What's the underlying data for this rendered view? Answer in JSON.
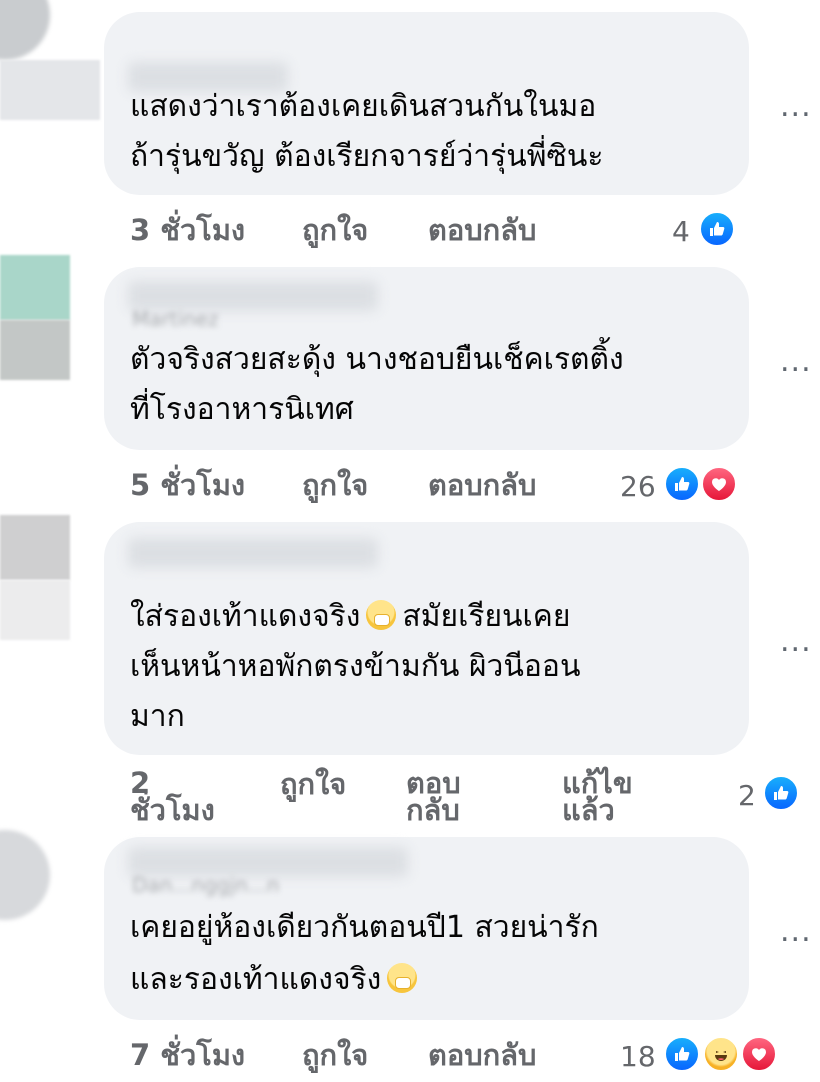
{
  "comments": [
    {
      "lines": [
        "แสดงว่าเราต้องเคยเดินสวนกันในมอ",
        "ถ้ารุ่นขวัญ ต้องเรียกจารย์ว่ารุ่นพี่ซินะ"
      ],
      "time": "3 ชั่วโมง",
      "like": "ถูกใจ",
      "reply": "ตอบกลับ",
      "reaction_count": "4",
      "reactions": [
        "like-icon"
      ]
    },
    {
      "name_fragment": "Martinez",
      "lines": [
        "ตัวจริงสวยสะดุ้ง นางชอบยืนเช็คเรตติ้ง",
        "ที่โรงอาหารนิเทศ"
      ],
      "time": "5 ชั่วโมง",
      "like": "ถูกใจ",
      "reply": "ตอบกลับ",
      "reaction_count": "26",
      "reactions": [
        "like-icon",
        "love-icon"
      ]
    },
    {
      "line1_a": "ใส่รองเท้าแดงจริง",
      "line1_b": "สมัยเรียนเคย",
      "lines": [
        "เห็นหน้าหอพักตรงข้ามกัน ผิวนีออน",
        "มาก"
      ],
      "time": "2 ชั่วโมง",
      "like": "ถูกใจ",
      "reply": "ตอบ กลับ",
      "edited": "แก้ไข แล้ว",
      "reaction_count": "2",
      "reactions": [
        "like-icon"
      ]
    },
    {
      "name_fragment": "Dan...nggjn...n",
      "lines": [
        "เคยอยู่ห้องเดียวกันตอนปี1 สวยน่ารัก"
      ],
      "line2_a": "และรองเท้าแดงจริง",
      "time": "7 ชั่วโมง",
      "like": "ถูกใจ",
      "reply": "ตอบกลับ",
      "reaction_count": "18",
      "reactions": [
        "like-icon",
        "haha-icon",
        "love-icon"
      ]
    }
  ],
  "more_label": "...",
  "colors": {
    "bubble": "#f0f2f5",
    "meta": "#65676b",
    "like": "#0866ff",
    "love": "#e61739"
  }
}
